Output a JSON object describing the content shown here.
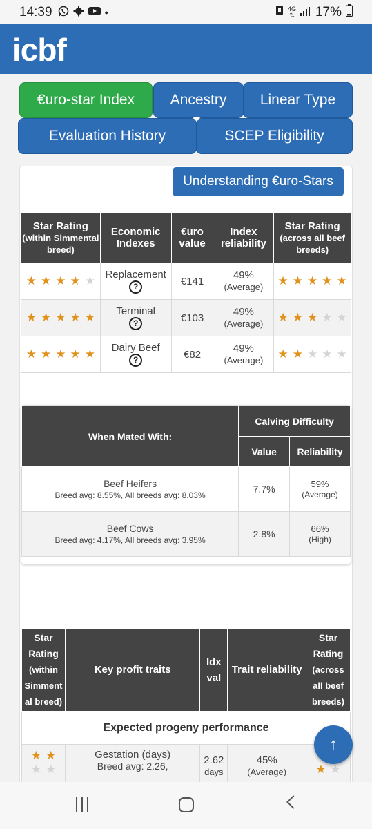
{
  "status_bar": {
    "time": "14:39",
    "net_top": "4G",
    "battery": "17%"
  },
  "header": {
    "logo": "icbf"
  },
  "tabs": [
    {
      "label": "€uro-star Index",
      "active": true
    },
    {
      "label": "Ancestry"
    },
    {
      "label": "Linear Type"
    },
    {
      "label": "Evaluation History"
    },
    {
      "label": "SCEP Eligibility"
    }
  ],
  "understanding_button": "Understanding €uro-Stars",
  "index_table": {
    "headers": {
      "star_within_title": "Star Rating",
      "star_within_sub": "(within Simmental breed)",
      "economic_indexes": "Economic Indexes",
      "euro_value": "€uro value",
      "index_reliability": "Index reliability",
      "star_across_title": "Star Rating",
      "star_across_sub": "(across all beef breeds)"
    },
    "rows": [
      {
        "index": "Replacement",
        "value": "€141",
        "reliability": "49%",
        "reliability_label": "(Average)",
        "stars_within": 4,
        "stars_across": 5
      },
      {
        "index": "Terminal",
        "value": "€103",
        "reliability": "49%",
        "reliability_label": "(Average)",
        "stars_within": 5,
        "stars_across": 3
      },
      {
        "index": "Dairy Beef",
        "value": "€82",
        "reliability": "49%",
        "reliability_label": "(Average)",
        "stars_within": 5,
        "stars_across": 2
      }
    ]
  },
  "calving_table": {
    "when_mated": "When Mated With:",
    "calving_difficulty": "Calving Difficulty",
    "value": "Value",
    "reliability": "Reliability",
    "rows": [
      {
        "name": "Beef Heifers",
        "sub": "Breed avg: 8.55%, All breeds avg: 8.03%",
        "value": "7.7%",
        "reliability": "59%",
        "reliability_label": "(Average)"
      },
      {
        "name": "Beef Cows",
        "sub": "Breed avg: 4.17%, All breeds avg: 3.95%",
        "value": "2.8%",
        "reliability": "66%",
        "reliability_label": "(High)"
      }
    ]
  },
  "traits_table": {
    "star_within_1": "Star",
    "star_within_2": "Rating",
    "star_within_3": "(within",
    "star_within_4": "Simment",
    "star_within_5": "al breed)",
    "key_profit": "Key profit traits",
    "idx_1": "Idx",
    "idx_2": "val",
    "trait_reliability": "Trait reliability",
    "star_across_1": "Star",
    "star_across_2": "Rating",
    "star_across_3": "(across",
    "star_across_4": "all beef",
    "star_across_5": "breeds)",
    "section": "Expected progeny performance",
    "row": {
      "name": "Gestation (days)",
      "sub": "Breed avg: 2.26,",
      "value": "2.62",
      "unit": "days",
      "reliability": "45%",
      "reliability_label": "(Average)"
    }
  },
  "fab_icon": "arrow-up-icon",
  "colors": {
    "primary": "#2d6db5",
    "active_tab": "#2eaa4a",
    "star": "#e0921d",
    "table_header": "#444444"
  }
}
